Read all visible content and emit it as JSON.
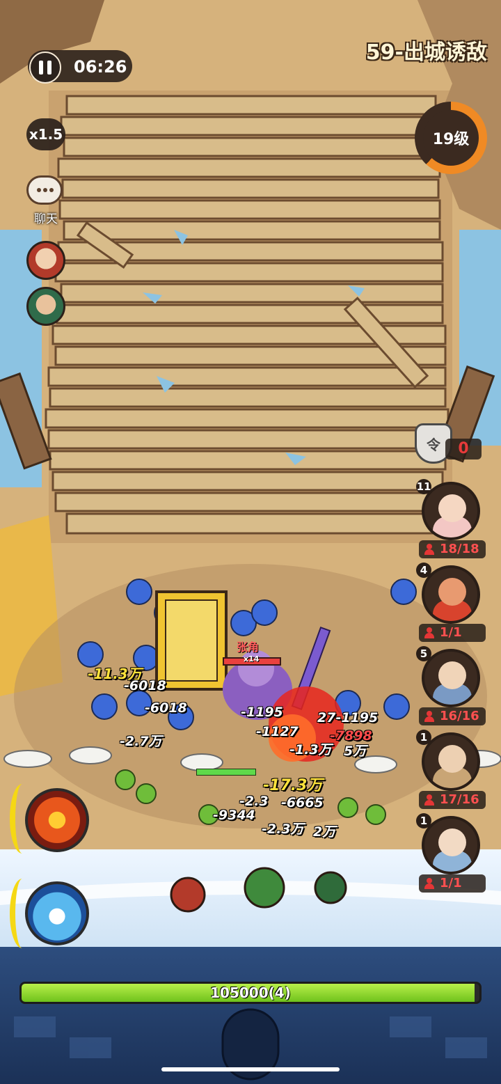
{
  "hud": {
    "timer": "06:26",
    "speed": "x1.5",
    "chat_label": "聊天",
    "stage_title": "59-出城诱敌",
    "level": "19级",
    "level_progress_fraction": 0.62,
    "token_count": "0"
  },
  "heroes_left": [
    {
      "name": "hero-avatar-elder"
    },
    {
      "name": "hero-avatar-warrior"
    }
  ],
  "units": [
    {
      "num": "11",
      "count": "18/18",
      "color": "#f3c7c4"
    },
    {
      "num": "4",
      "count": "1/1",
      "color": "#d8432d"
    },
    {
      "num": "5",
      "count": "16/16",
      "color": "#7a9ac4"
    },
    {
      "num": "1",
      "count": "17/16",
      "color": "#c9a575"
    },
    {
      "num": "1",
      "count": "1/1",
      "color": "#8fb4d8"
    }
  ],
  "boss": {
    "name": "张角",
    "stack": "x14"
  },
  "damage_numbers": [
    {
      "text": "-11.3万",
      "color": "yellow"
    },
    {
      "text": "-6018",
      "color": "white"
    },
    {
      "text": "-6018",
      "color": "white"
    },
    {
      "text": "-2.7万",
      "color": "white"
    },
    {
      "text": "-1195",
      "color": "white"
    },
    {
      "text": "27-1195",
      "color": "white"
    },
    {
      "text": "-1127",
      "color": "white"
    },
    {
      "text": "-7898",
      "color": "red"
    },
    {
      "text": "-1.3万",
      "color": "white"
    },
    {
      "text": "5万",
      "color": "white"
    },
    {
      "text": "-17.3万",
      "color": "yellow"
    },
    {
      "text": "-2.3",
      "color": "white"
    },
    {
      "text": "-6665",
      "color": "white"
    },
    {
      "text": "-9344",
      "color": "white"
    },
    {
      "text": "-2.3万",
      "color": "white"
    },
    {
      "text": "2万",
      "color": "white"
    }
  ],
  "base_hp": {
    "text": "105000(4)",
    "fraction": 0.99
  },
  "colors": {
    "hud_dark": "#2b221d",
    "level_ring": "#f08a24",
    "hp_green": "#7fd324",
    "damage_red": "#ff4b4b"
  }
}
